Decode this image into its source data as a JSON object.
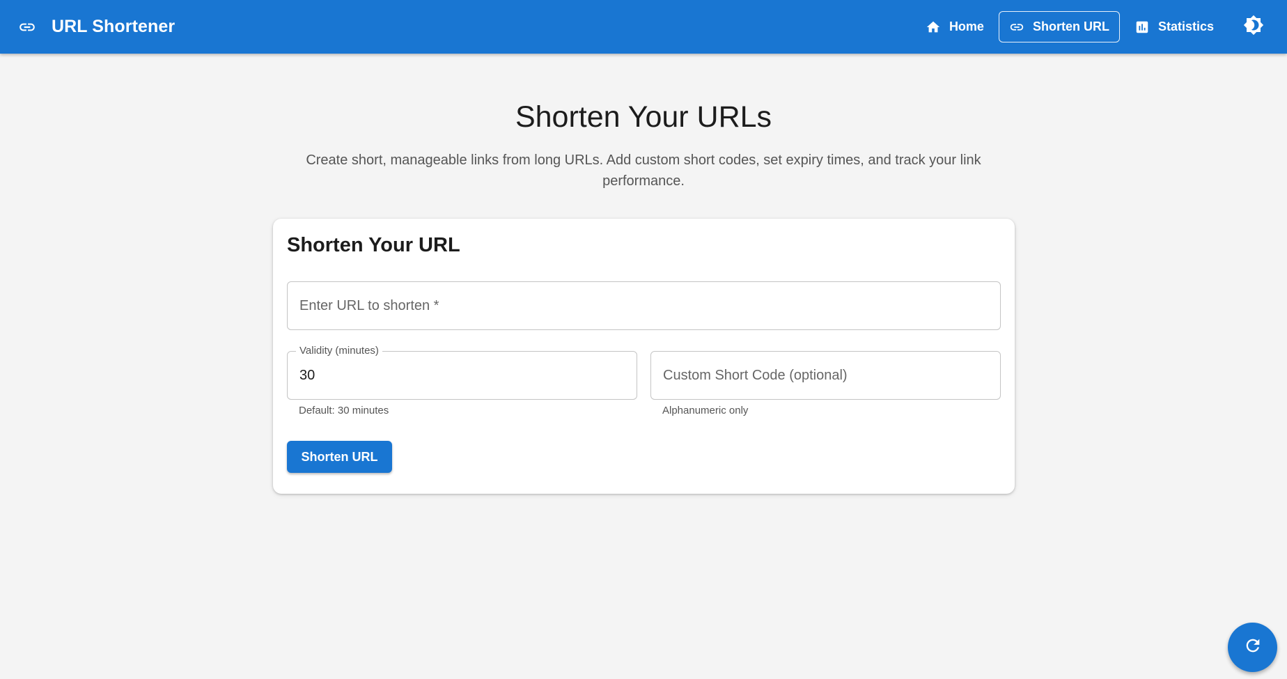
{
  "appbar": {
    "title": "URL Shortener",
    "brand_icon": "link-icon",
    "nav": [
      {
        "label": "Home",
        "icon": "home-icon",
        "active": false
      },
      {
        "label": "Shorten URL",
        "icon": "link-icon",
        "active": true
      },
      {
        "label": "Statistics",
        "icon": "bar-chart-icon",
        "active": false
      }
    ],
    "theme_toggle_icon": "brightness-icon"
  },
  "hero": {
    "title": "Shorten Your URLs",
    "subtitle": "Create short, manageable links from long URLs. Add custom short codes, set expiry times, and track your link performance."
  },
  "form": {
    "title": "Shorten Your URL",
    "url_field": {
      "placeholder": "Enter URL to shorten *",
      "value": ""
    },
    "validity_field": {
      "label": "Validity (minutes)",
      "value": "30",
      "helper": "Default: 30 minutes"
    },
    "shortcode_field": {
      "placeholder": "Custom Short Code (optional)",
      "value": "",
      "helper": "Alphanumeric only"
    },
    "submit_label": "Shorten URL"
  },
  "fab_icon": "refresh-icon",
  "colors": {
    "primary": "#1976d2",
    "background": "#f4f4f4",
    "surface": "#ffffff"
  }
}
